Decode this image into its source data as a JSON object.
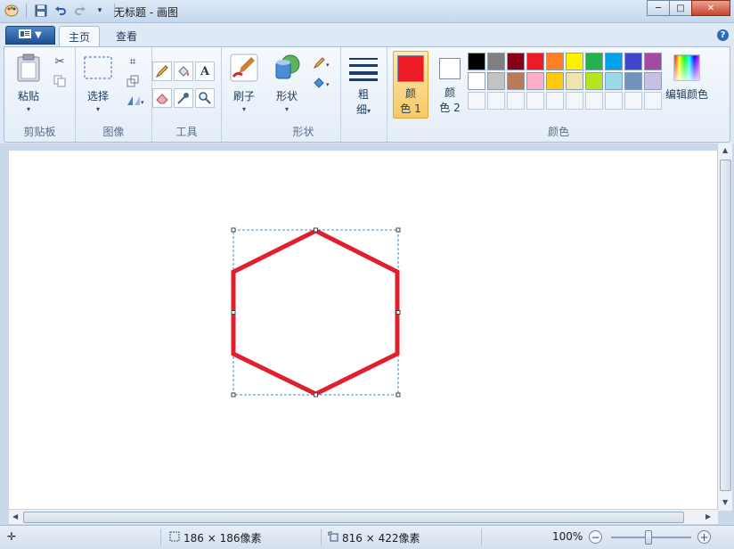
{
  "window": {
    "title": "无标题 - 画图",
    "minimize_label": "─",
    "maximize_label": "□",
    "close_label": "✕"
  },
  "quick_access": {
    "app_icon": "paint-palette-icon",
    "save_icon": "floppy-save-icon",
    "undo_icon": "undo-icon",
    "redo_icon": "redo-icon"
  },
  "tabs": [
    {
      "label": "主页",
      "active": true
    },
    {
      "label": "查看",
      "active": false
    }
  ],
  "ribbon": {
    "clipboard": {
      "paste_label": "粘贴",
      "group_label": "剪贴板"
    },
    "image": {
      "select_label": "选择",
      "group_label": "图像"
    },
    "tools": {
      "group_label": "工具"
    },
    "brushes": {
      "label": "刷子"
    },
    "shapes": {
      "label": "形状",
      "group_label": "形状"
    },
    "size": {
      "label_top": "粗",
      "label_bottom": "细"
    },
    "colors": {
      "color1_top": "颜",
      "color1_bottom": "色 1",
      "color2_top": "颜",
      "color2_bottom": "色 2",
      "color1_value": "#ed1c24",
      "color2_value": "#ffffff",
      "edit_label": "编辑颜色",
      "group_label": "颜色",
      "palette_row1": [
        "#000000",
        "#7f7f7f",
        "#880015",
        "#ed1c24",
        "#ff7f27",
        "#fff200",
        "#22b14c",
        "#00a2e8",
        "#3f48cc",
        "#a349a4"
      ],
      "palette_row2": [
        "#ffffff",
        "#c3c3c3",
        "#b97a57",
        "#ffaec9",
        "#ffc90e",
        "#efe4b0",
        "#b5e61d",
        "#99d9ea",
        "#7092be",
        "#c8bfe7"
      ]
    }
  },
  "canvas": {
    "shape": "hexagon",
    "stroke_color": "#e0202e",
    "selection_color": "#3a8fcf"
  },
  "status": {
    "selection_size": "186 × 186像素",
    "canvas_size": "816 × 422像素",
    "zoom": "100%"
  }
}
